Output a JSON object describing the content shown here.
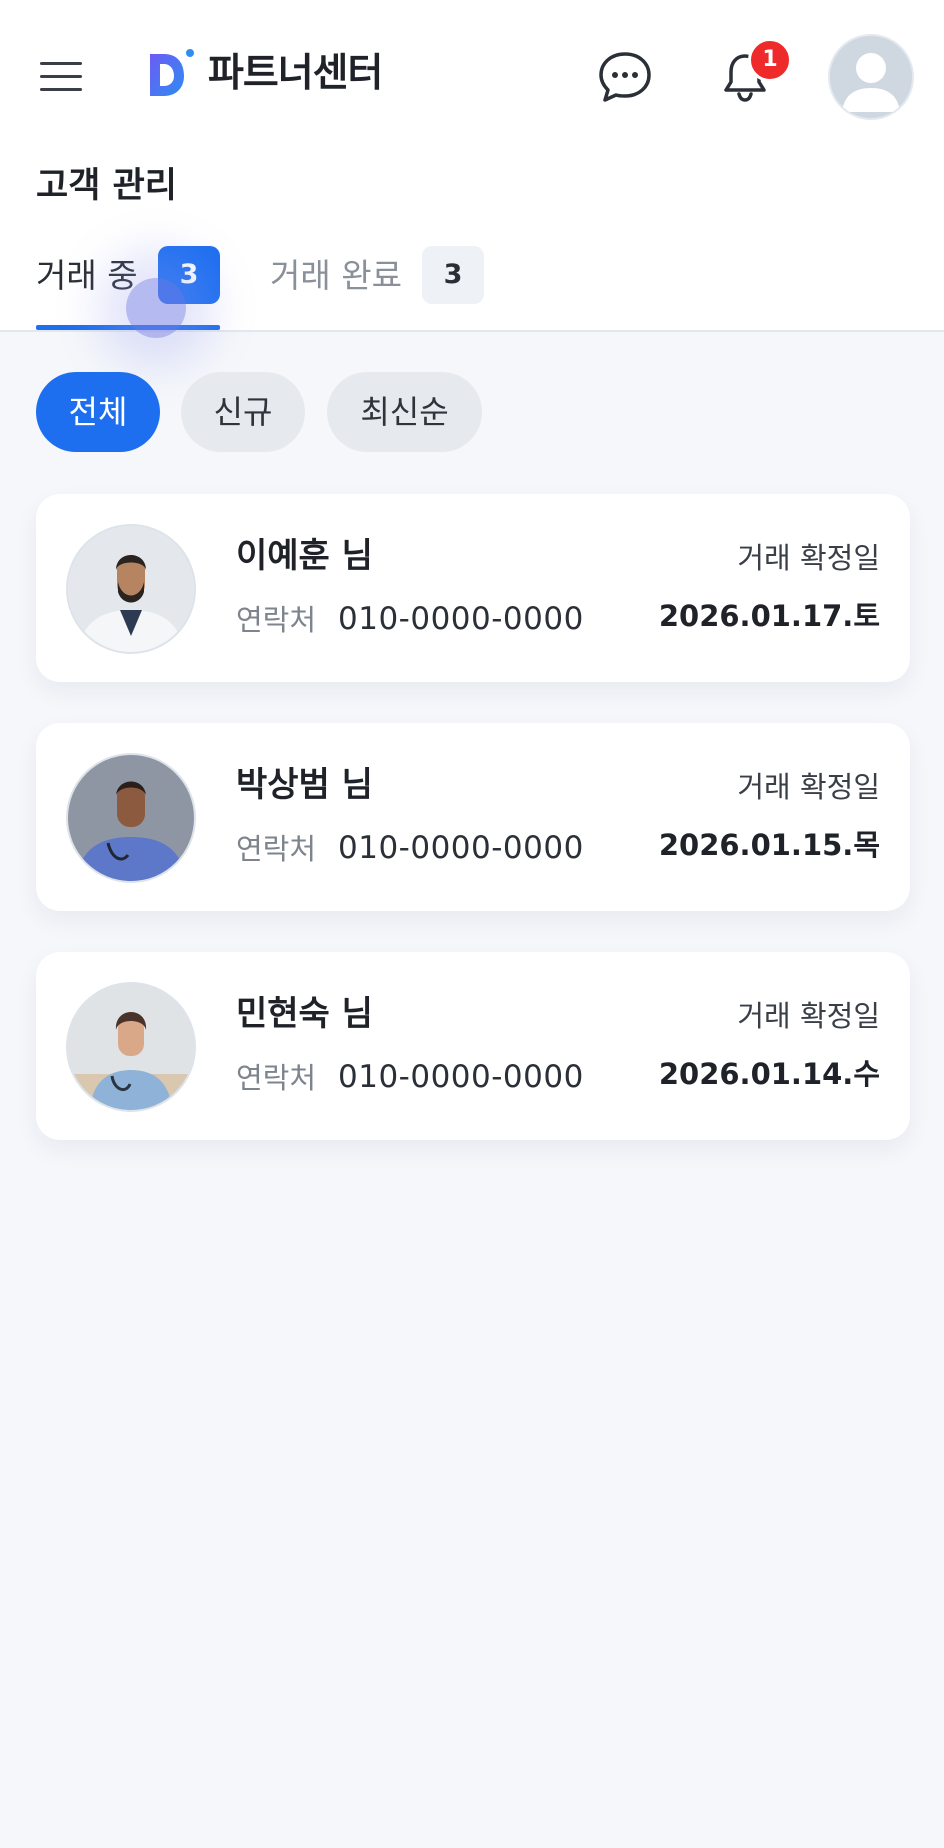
{
  "header": {
    "logo_text": "파트너센터",
    "notification_count": "1",
    "accent_color": "#1e6ff0",
    "icons": [
      "menu-icon",
      "logo-icon",
      "chat-icon",
      "bell-icon",
      "user-avatar-icon"
    ]
  },
  "page": {
    "title": "고객 관리"
  },
  "tabs": [
    {
      "label": "거래 중",
      "count": "3",
      "active": true
    },
    {
      "label": "거래 완료",
      "count": "3",
      "active": false
    }
  ],
  "filters": [
    {
      "label": "전체",
      "active": true
    },
    {
      "label": "신규",
      "active": false
    },
    {
      "label": "최신순",
      "active": false
    }
  ],
  "customers": [
    {
      "name": "이예훈 님",
      "contact_label": "연락처",
      "phone": "010-0000-0000",
      "date_label": "거래 확정일",
      "date": "2026.01.17.토"
    },
    {
      "name": "박상범 님",
      "contact_label": "연락처",
      "phone": "010-0000-0000",
      "date_label": "거래 확정일",
      "date": "2026.01.15.목"
    },
    {
      "name": "민현숙 님",
      "contact_label": "연락처",
      "phone": "010-0000-0000",
      "date_label": "거래 확정일",
      "date": "2026.01.14.수"
    }
  ]
}
